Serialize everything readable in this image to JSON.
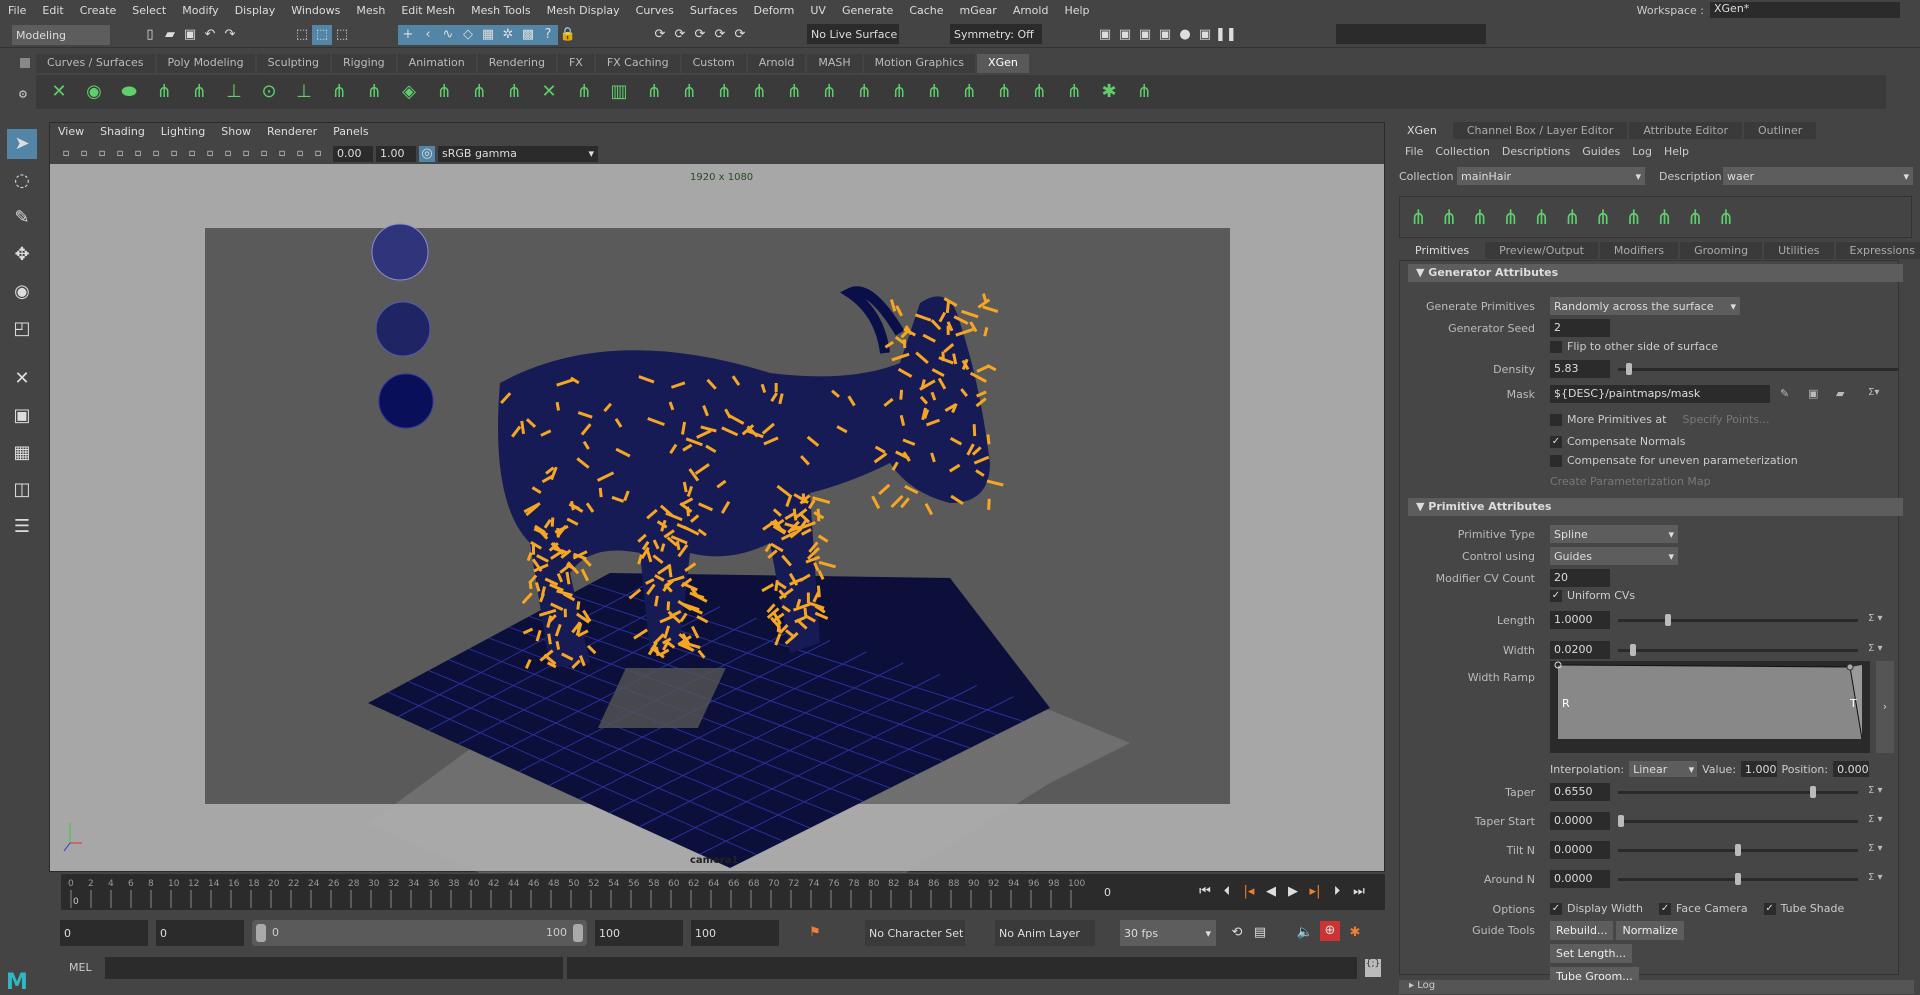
{
  "menubar": [
    "File",
    "Edit",
    "Create",
    "Select",
    "Modify",
    "Display",
    "Windows",
    "Mesh",
    "Edit Mesh",
    "Mesh Tools",
    "Mesh Display",
    "Curves",
    "Surfaces",
    "Deform",
    "UV",
    "Generate",
    "Cache",
    "mGear",
    "Arnold",
    "Help"
  ],
  "workspace": {
    "label": "Workspace :",
    "value": "XGen*"
  },
  "status": {
    "mode": "Modeling",
    "live_surface": "No Live Surface",
    "symmetry": "Symmetry: Off"
  },
  "shelf_tabs": [
    "Curves / Surfaces",
    "Poly Modeling",
    "Sculpting",
    "Rigging",
    "Animation",
    "Rendering",
    "FX",
    "FX Caching",
    "Custom",
    "Arnold",
    "MASH",
    "Motion Graphics",
    "XGen"
  ],
  "shelf_active": "XGen",
  "viewport": {
    "menu": [
      "View",
      "Shading",
      "Lighting",
      "Show",
      "Renderer",
      "Panels"
    ],
    "exposure": "0.00",
    "gamma": "1.00",
    "colorspace": "sRGB gamma",
    "resolution": "1920 x 1080",
    "camera": "camera1"
  },
  "timeline": {
    "ticks": [
      "0",
      "2",
      "4",
      "6",
      "8",
      "10",
      "12",
      "14",
      "16",
      "18",
      "20",
      "22",
      "24",
      "26",
      "28",
      "30",
      "32",
      "34",
      "36",
      "38",
      "40",
      "42",
      "44",
      "46",
      "48",
      "50",
      "52",
      "54",
      "56",
      "58",
      "60",
      "62",
      "64",
      "66",
      "68",
      "70",
      "72",
      "74",
      "76",
      "78",
      "80",
      "82",
      "84",
      "86",
      "88",
      "90",
      "92",
      "94",
      "96",
      "98",
      "100"
    ],
    "current_frame": "0",
    "current_marker": "0"
  },
  "range": {
    "start": "0",
    "anim_start": "0",
    "slider_start": "0",
    "slider_end": "100",
    "anim_end": "100",
    "end": "100",
    "character_set": "No Character Set",
    "anim_layer": "No Anim Layer",
    "fps": "30 fps"
  },
  "mel": {
    "label": "MEL"
  },
  "panel": {
    "tabs": [
      "XGen",
      "Channel Box / Layer Editor",
      "Attribute Editor",
      "Outliner"
    ],
    "menu": [
      "File",
      "Collection",
      "Descriptions",
      "Guides",
      "Log",
      "Help"
    ],
    "collection_label": "Collection",
    "collection": "mainHair",
    "description_label": "Description",
    "description": "waer",
    "subtabs": [
      "Primitives",
      "Preview/Output",
      "Modifiers",
      "Grooming",
      "Utilities",
      "Expressions"
    ],
    "generator": {
      "title": "Generator Attributes",
      "generate_label": "Generate Primitives",
      "generate": "Randomly across the surface",
      "seed_label": "Generator Seed",
      "seed": "2",
      "flip": "Flip to other side of surface",
      "density_label": "Density",
      "density": "5.83",
      "density_frac": 0.03,
      "mask_label": "Mask",
      "mask": "${DESC}/paintmaps/mask",
      "more": "More Primitives at",
      "specify": "Specify Points...",
      "comp_normals": "Compensate Normals",
      "comp_uneven": "Compensate for uneven parameterization",
      "create_map": "Create Parameterization Map"
    },
    "primitive": {
      "title": "Primitive Attributes",
      "type_label": "Primitive Type",
      "type": "Spline",
      "control_label": "Control using",
      "control": "Guides",
      "cv_label": "Modifier CV Count",
      "cv": "20",
      "uniform": "Uniform CVs",
      "sliders": [
        {
          "label": "Length",
          "value": "1.0000",
          "frac": 0.2
        },
        {
          "label": "Width",
          "value": "0.0200",
          "frac": 0.05
        }
      ],
      "ramp_label": "Width Ramp",
      "ramp_r": "R",
      "ramp_t": "T",
      "interp_label": "Interpolation:",
      "interp": "Linear",
      "value_label": "Value:",
      "value": "1.000",
      "position_label": "Position:",
      "position": "0.000",
      "sliders2": [
        {
          "label": "Taper",
          "value": "0.6550",
          "frac": 0.82
        },
        {
          "label": "Taper Start",
          "value": "0.0000",
          "frac": 0.0
        },
        {
          "label": "Tilt N",
          "value": "0.0000",
          "frac": 0.5
        },
        {
          "label": "Around N",
          "value": "0.0000",
          "frac": 0.5
        }
      ],
      "options_label": "Options",
      "options": [
        "Display Width",
        "Face Camera",
        "Tube Shade"
      ],
      "guide_tools_label": "Guide Tools",
      "guide_tools": [
        "Rebuild...",
        "Normalize",
        "Set Length...",
        "Tube Groom..."
      ]
    },
    "log": "Log"
  },
  "colors": {
    "accent": "#5285a6",
    "hair": "#f5a623",
    "mesh": "#0a0f4a"
  }
}
